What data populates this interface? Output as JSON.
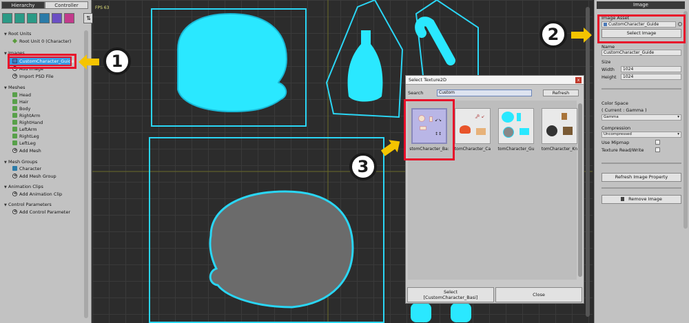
{
  "left_panel": {
    "tabs": [
      "Hierarchy",
      "Controller"
    ],
    "sections": {
      "root_units": "Root Units",
      "root_unit_item": "Root Unit 0 (Character)",
      "images": "Images",
      "image_item": "CustomCharacter_Guide",
      "add_image": "Add Image",
      "import_psd": "Import PSD File",
      "meshes": "Meshes",
      "mesh_items": [
        "Head",
        "Hair",
        "Body",
        "RightArm",
        "RightHand",
        "LeftArm",
        "RightLeg",
        "LeftLeg"
      ],
      "add_mesh": "Add Mesh",
      "mesh_groups": "Mesh Groups",
      "mesh_group_item": "Character",
      "add_mesh_group": "Add Mesh Group",
      "animation_clips": "Animation Clips",
      "add_animation_clip": "Add Animation Clip",
      "control_parameters": "Control Parameters",
      "add_control_parameter": "Add Control Parameter"
    }
  },
  "viewport": {
    "fps": "FPS 63",
    "accent": "#2ad6f5"
  },
  "dialog": {
    "title": "Select Texture2D",
    "close_x": "x",
    "search_label": "Search",
    "search_value": "Custom",
    "refresh": "Refresh",
    "thumbnails": [
      "stomCharacter_Ba:",
      "tomCharacter_Ca",
      "tomCharacter_Gu",
      "tomCharacter_Kn"
    ],
    "select_line1": "Select",
    "select_line2": "[CustomCharacter_Basi]",
    "close": "Close"
  },
  "right_panel": {
    "tab": "Image",
    "image_asset_label": "Image Asset",
    "image_asset_value": "CustomCharacter_Guide",
    "select_image": "Select Image",
    "name_label": "Name",
    "name_value": "CustomCharacter_Guide",
    "size_label": "Size",
    "width_label": "Width",
    "width_value": "1024",
    "height_label": "Height",
    "height_value": "1024",
    "color_space_label": "Color Space",
    "color_space_current": "( Current : Gamma )",
    "color_space_value": "Gamma",
    "compression_label": "Compression",
    "compression_value": "Uncompressed",
    "use_mipmap": "Use Mipmap",
    "texture_rw": "Texture Read/Write",
    "refresh_property": "Refresh Image Property",
    "remove_image": "Remove Image"
  },
  "callouts": [
    "1",
    "2",
    "3"
  ],
  "colors": {
    "highlight": "#e8102a",
    "arrow": "#f5c400",
    "selection": "#3a9ae0"
  }
}
